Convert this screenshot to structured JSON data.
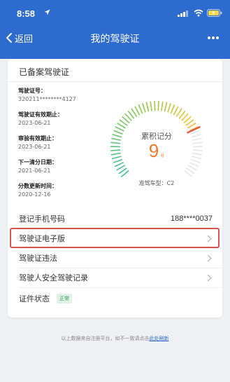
{
  "status_bar": {
    "time": "8:58"
  },
  "nav": {
    "back_label": "返回",
    "title": "我的驾驶证"
  },
  "card": {
    "title": "已备案驾驶证",
    "info": [
      {
        "label": "驾驶证号：",
        "value": "320211********4127"
      },
      {
        "label": "驾驶证有效期止：",
        "value": "2023-06-21"
      },
      {
        "label": "审验有效期止：",
        "value": "2023-06-21"
      },
      {
        "label": "下一清分日期：",
        "value": "2021-06-21"
      },
      {
        "label": "分数更新时间：",
        "value": "2020-12-16"
      }
    ],
    "gauge": {
      "label": "累积记分",
      "value": "9",
      "unit": "分",
      "vehicle": "准驾车型：C2",
      "progress": 0.75
    },
    "rows": {
      "phone_label": "登记手机号码",
      "phone_value": "188****0037",
      "e_license": "驾驶证电子版",
      "violations": "驾驶证违法",
      "safe_record": "驾驶人安全驾驶记录",
      "status_label": "证件状态",
      "status_value": "正常"
    }
  },
  "footer": {
    "note": "以上数据来自注册平台，如不一致请点击",
    "link": "此处刷新"
  },
  "colors": {
    "brand": "#2d6bcf",
    "highlight": "#d9534f",
    "score": "#f07a2a",
    "ok": "#2e9b5b"
  }
}
